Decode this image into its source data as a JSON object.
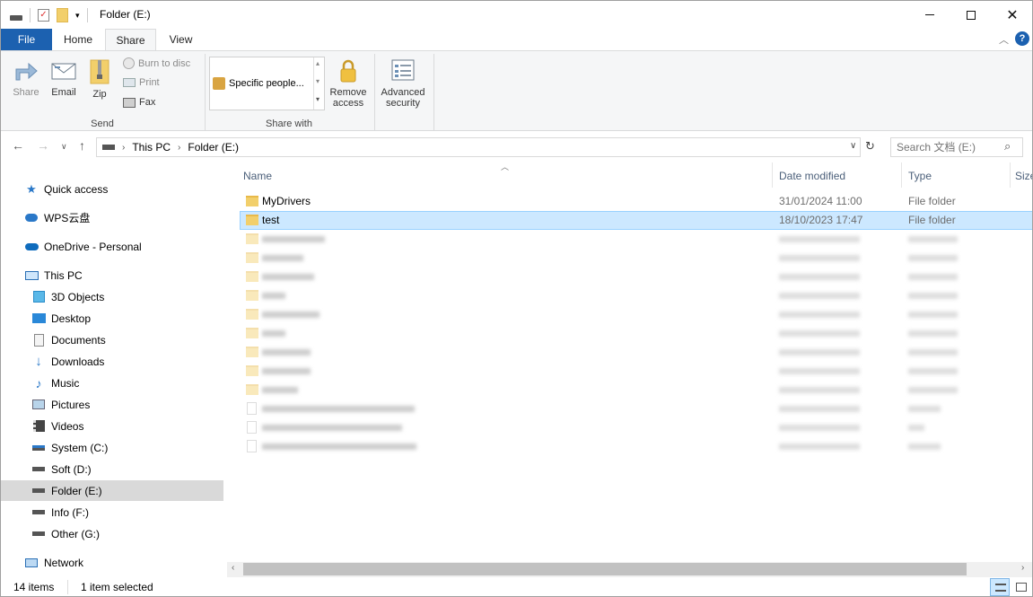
{
  "window": {
    "title": "Folder (E:)"
  },
  "ribbon_tabs": [
    "File",
    "Home",
    "Share",
    "View"
  ],
  "ribbon": {
    "send": {
      "label": "Send",
      "share": "Share",
      "email": "Email",
      "zip": "Zip",
      "burn": "Burn to disc",
      "print": "Print",
      "fax": "Fax"
    },
    "share_with": {
      "label": "Share with",
      "specific": "Specific people...",
      "remove_access": [
        "Remove",
        "access"
      ],
      "advanced_security": [
        "Advanced",
        "security"
      ]
    }
  },
  "address": {
    "path": [
      "This PC",
      "Folder (E:)"
    ]
  },
  "search": {
    "placeholder": "Search 文档 (E:)"
  },
  "nav": {
    "items": [
      {
        "label": "Quick access",
        "icon": "star-icon"
      },
      {
        "label": "WPS云盘",
        "icon": "cloud-icon"
      },
      {
        "label": "OneDrive - Personal",
        "icon": "onedrive-icon"
      },
      {
        "label": "This PC",
        "icon": "computer-icon"
      },
      {
        "label": "3D Objects",
        "icon": "cube-icon"
      },
      {
        "label": "Desktop",
        "icon": "desktop-icon"
      },
      {
        "label": "Documents",
        "icon": "documents-icon"
      },
      {
        "label": "Downloads",
        "icon": "downloads-icon"
      },
      {
        "label": "Music",
        "icon": "music-icon"
      },
      {
        "label": "Pictures",
        "icon": "pictures-icon"
      },
      {
        "label": "Videos",
        "icon": "videos-icon"
      },
      {
        "label": "System (C:)",
        "icon": "drive-icon"
      },
      {
        "label": "Soft (D:)",
        "icon": "drive-icon"
      },
      {
        "label": "Folder (E:)",
        "icon": "drive-icon"
      },
      {
        "label": "Info (F:)",
        "icon": "drive-icon"
      },
      {
        "label": "Other (G:)",
        "icon": "drive-icon"
      },
      {
        "label": "Network",
        "icon": "network-icon"
      }
    ]
  },
  "columns": [
    "Name",
    "Date modified",
    "Type",
    "Size"
  ],
  "files": [
    {
      "name": "MyDrivers",
      "date": "31/01/2024 11:00",
      "type": "File folder",
      "size": ""
    },
    {
      "name": "test",
      "date": "18/10/2023 17:47",
      "type": "File folder",
      "size": ""
    }
  ],
  "status": {
    "items": "14 items",
    "selected": "1 item selected"
  },
  "colors": {
    "accent": "#1c61b0",
    "selection": "#cce8ff",
    "folder": "#f2cf6b"
  }
}
